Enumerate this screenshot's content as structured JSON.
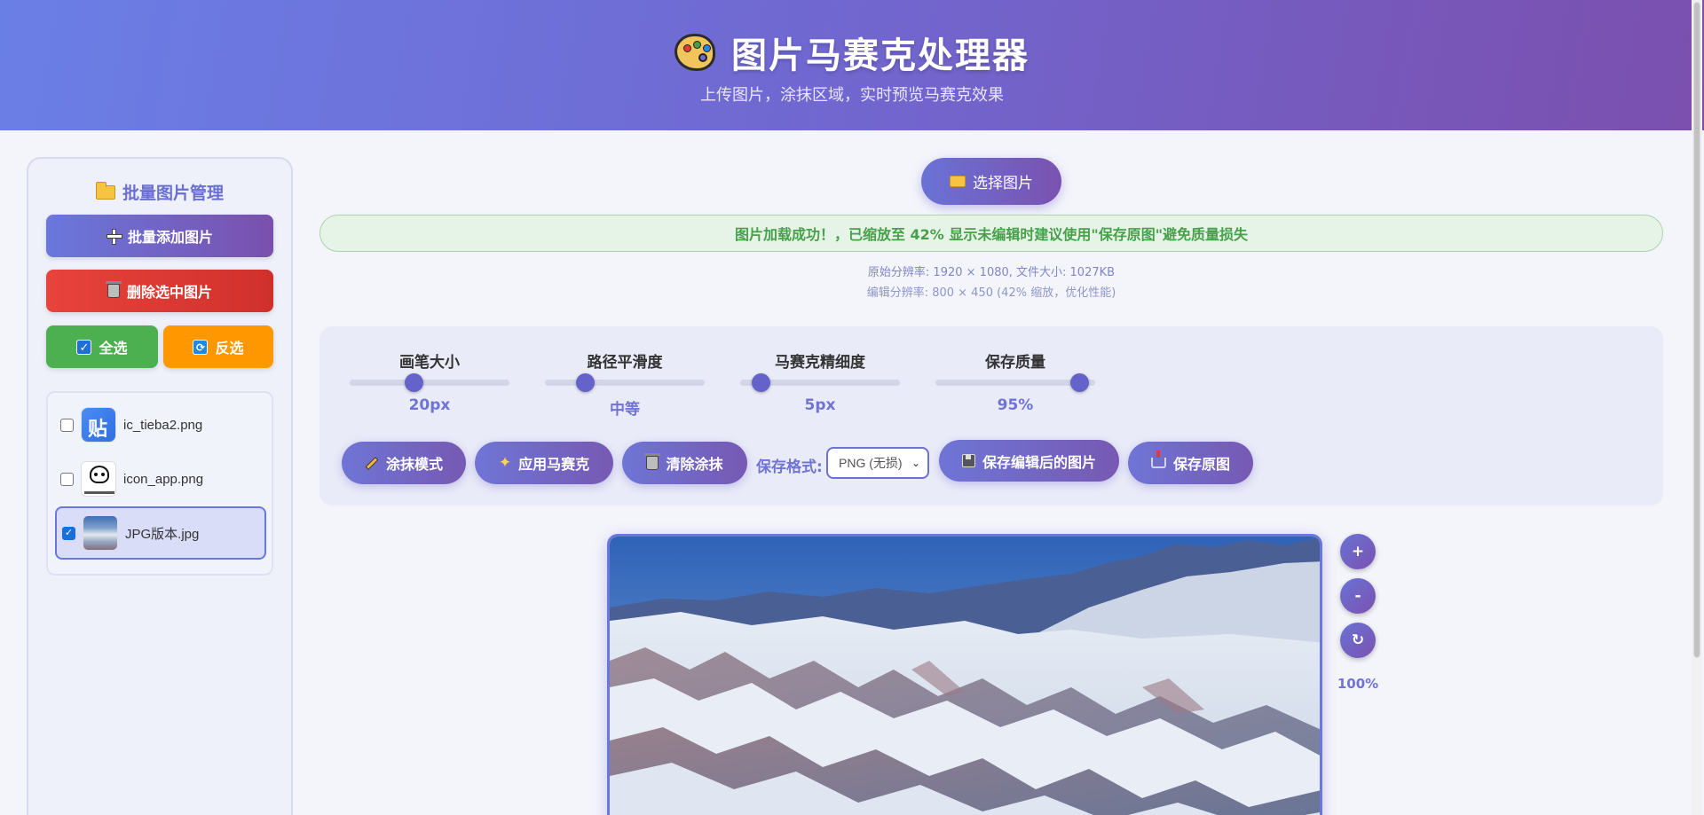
{
  "header": {
    "title": "图片马赛克处理器",
    "subtitle": "上传图片，涂抹区域，实时预览马赛克效果",
    "icon": "palette-icon"
  },
  "sidebar": {
    "title": "批量图片管理",
    "add_label": "批量添加图片",
    "delete_label": "删除选中图片",
    "select_all_label": "全选",
    "invert_label": "反选",
    "files": [
      {
        "name": "ic_tieba2.png",
        "checked": false,
        "thumb_text": "贴"
      },
      {
        "name": "icon_app.png",
        "checked": false
      },
      {
        "name": "JPG版本.jpg",
        "checked": true
      }
    ]
  },
  "main": {
    "choose_label": "选择图片",
    "success_message": "图片加载成功！，已缩放至 42% 显示未编辑时建议使用\"保存原图\"避免质量损失",
    "original_info": "原始分辨率: 1920 × 1080, 文件大小: 1027KB",
    "edit_info": "编辑分辨率: 800 × 450 (42% 缩放，优化性能)"
  },
  "sliders": [
    {
      "label": "画笔大小",
      "value": "20px",
      "fraction": 0.4
    },
    {
      "label": "路径平滑度",
      "value": "中等",
      "fraction": 0.25
    },
    {
      "label": "马赛克精细度",
      "value": "5px",
      "fraction": 0.13
    },
    {
      "label": "保存质量",
      "value": "95%",
      "fraction": 0.9
    }
  ],
  "toolbar": {
    "paint_mode_label": "涂抹模式",
    "apply_label": "应用马赛克",
    "clear_label": "清除涂抹",
    "format_label": "保存格式:",
    "format_value": "PNG (无损)",
    "save_edited_label": "保存编辑后的图片",
    "save_original_label": "保存原图"
  },
  "zoom": {
    "in_label": "+",
    "out_label": "-",
    "reset_label": "↻",
    "level": "100%"
  },
  "colors": {
    "accent": "#6a72d6",
    "success": "#47a04a",
    "danger": "#e8433c",
    "select_all": "#4caf50",
    "invert": "#ff9800"
  }
}
